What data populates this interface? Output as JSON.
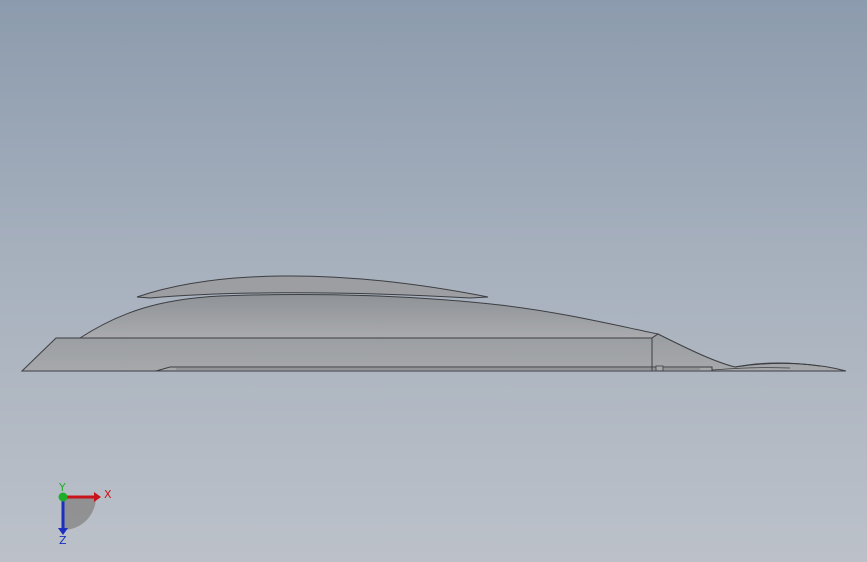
{
  "viewport": {
    "background_top": "#8c9bad",
    "background_bottom": "#bcc1c9"
  },
  "model": {
    "shape": "aerodynamic-body-side-view",
    "fill_color": "#a0a2a5",
    "edge_color": "#3c3e42"
  },
  "triad": {
    "x_label": "X",
    "y_label": "Y",
    "z_label": "Z",
    "x_color": "#c8141a",
    "y_color": "#1fae2a",
    "z_color": "#1a2ec0"
  }
}
